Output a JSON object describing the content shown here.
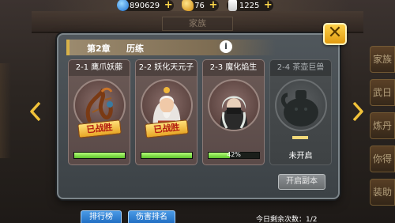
{
  "resources": [
    {
      "icon": "gem-icon",
      "value": "890629"
    },
    {
      "icon": "gold-ingot-icon",
      "value": "76"
    },
    {
      "icon": "scroll-icon",
      "value": "1225"
    }
  ],
  "background": {
    "sign": "家族",
    "side_buttons": [
      "家族",
      "武日",
      "炼丹",
      "你得",
      "装助"
    ]
  },
  "dialog": {
    "chapter": "第2章",
    "chapter_name": "历练",
    "info_label": "i",
    "close_label": "✕",
    "stages": [
      {
        "title": "2-1 鹰爪妖藤",
        "status": "已战胜",
        "progress": 1.0,
        "locked": false
      },
      {
        "title": "2-2 妖化天元子",
        "status": "已战胜",
        "progress": 1.0,
        "locked": false
      },
      {
        "title": "2-3 魔化焰生",
        "status": "",
        "progress": 0.42,
        "progress_label": "42%",
        "locked": false
      },
      {
        "title": "2-4 茶壶巨兽",
        "status": "未开启",
        "locked": true
      }
    ],
    "ranking_button": "排行榜",
    "damage_ranking_button": "伤害排名",
    "remaining_attempts": "今日剩余次数：1/2",
    "start_button": "开启副本"
  },
  "colors": {
    "accent_gold": "#e09a10",
    "progress_green": "#5cc42a",
    "button_blue": "#1f6cc0",
    "stamp_red": "#b21a10"
  }
}
